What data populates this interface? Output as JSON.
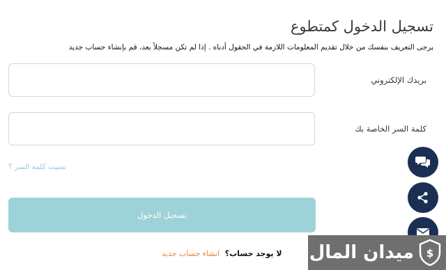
{
  "header": {
    "title": "تسجيل الدخول كمتطوع",
    "subtitle": "يرجى التعريف بنفسك من خلال تقديم المعلومات اللازمة في الحقول أدناه . إذا لم تكن مسجلاً بعد، قم بإنشاء حساب جديد"
  },
  "form": {
    "email_label": "بريدك الإلكتروني",
    "email_value": "",
    "password_label": "كلمة السر الخاصة بك",
    "password_value": "",
    "forgot_password": "نسيت كلمة السر ؟",
    "login_button": "تسجيل الدخول"
  },
  "footer": {
    "no_account_question": "لا يوجد حساب؟",
    "create_account_link": "انشاء حساب جديد"
  },
  "floating_actions": [
    {
      "icon": "chat-icon"
    },
    {
      "icon": "share-icon"
    },
    {
      "icon": "mail-icon"
    }
  ],
  "watermark": {
    "brand": "ميدان المال"
  },
  "colors": {
    "fab_background": "#1b2f52",
    "login_button": "#9dd3d8",
    "link_accent": "#8ecfd6",
    "create_link": "#e8833a",
    "watermark_bg": "#6f6f6f"
  }
}
